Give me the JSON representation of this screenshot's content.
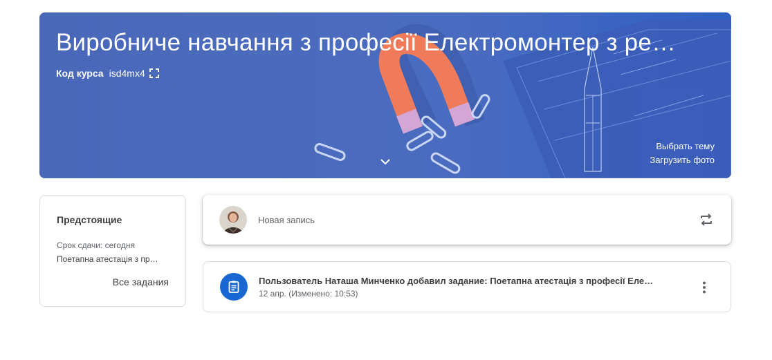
{
  "banner": {
    "title": "Виробниче навчання з професії Електромонтер з ре…",
    "course_code_label": "Код курса",
    "course_code_value": "isd4mx4",
    "select_theme": "Выбрать тему",
    "upload_photo": "Загрузить фото",
    "accent_color": "#4a6cc0"
  },
  "upcoming": {
    "title": "Предстоящие",
    "due": "Срок сдачи: сегодня",
    "item": "Поетапна атестація з пр…",
    "all_tasks": "Все задания"
  },
  "composer": {
    "placeholder": "Новая запись"
  },
  "stream": {
    "items": [
      {
        "title": "Пользователь Наташа Минченко добавил задание: Поетапна атестація з професії Еле…",
        "date": "12 апр. (Изменено: 10:53)",
        "icon": "assignment-icon",
        "icon_color": "#1967d2"
      }
    ]
  }
}
